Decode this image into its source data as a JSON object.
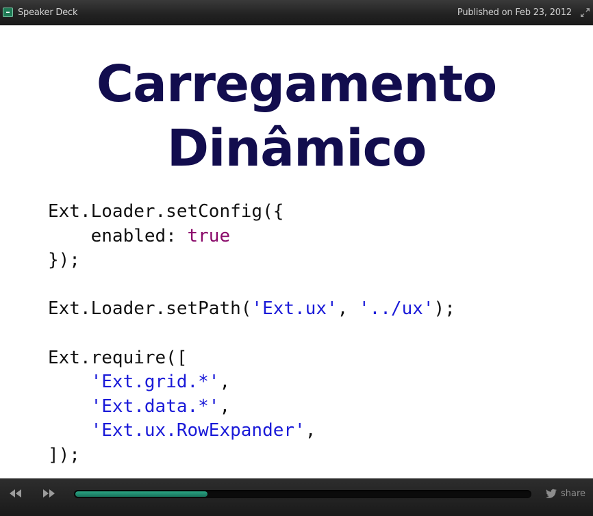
{
  "header": {
    "brand": "Speaker Deck",
    "published": "Published on Feb 23, 2012"
  },
  "slide": {
    "title_line1": "Carregamento",
    "title_line2": "Dinâmico",
    "code": [
      [
        {
          "t": "Ext.Loader.setConfig({"
        }
      ],
      [
        {
          "t": "    enabled: "
        },
        {
          "t": "true",
          "c": "kw"
        }
      ],
      [
        {
          "t": "});"
        }
      ],
      [
        {
          "t": ""
        }
      ],
      [
        {
          "t": "Ext.Loader.setPath("
        },
        {
          "t": "'Ext.ux'",
          "c": "str"
        },
        {
          "t": ", "
        },
        {
          "t": "'../ux'",
          "c": "str"
        },
        {
          "t": ");"
        }
      ],
      [
        {
          "t": ""
        }
      ],
      [
        {
          "t": "Ext.require(["
        }
      ],
      [
        {
          "t": "    "
        },
        {
          "t": "'Ext.grid.*'",
          "c": "str"
        },
        {
          "t": ","
        }
      ],
      [
        {
          "t": "    "
        },
        {
          "t": "'Ext.data.*'",
          "c": "str"
        },
        {
          "t": ","
        }
      ],
      [
        {
          "t": "    "
        },
        {
          "t": "'Ext.ux.RowExpander'",
          "c": "str"
        },
        {
          "t": ","
        }
      ],
      [
        {
          "t": "]);"
        }
      ]
    ]
  },
  "player": {
    "progress_fraction": 0.29,
    "share_label": "share"
  },
  "colors": {
    "title": "#120d4e",
    "keyword": "#8a0a6a",
    "string": "#1a1ad8",
    "progress": "#1f8c6c"
  },
  "icons": {
    "brand": "speaker-deck-logo-icon",
    "expand": "expand-icon",
    "previous": "rewind-icon",
    "next": "fast-forward-icon",
    "share": "twitter-bird-icon"
  }
}
